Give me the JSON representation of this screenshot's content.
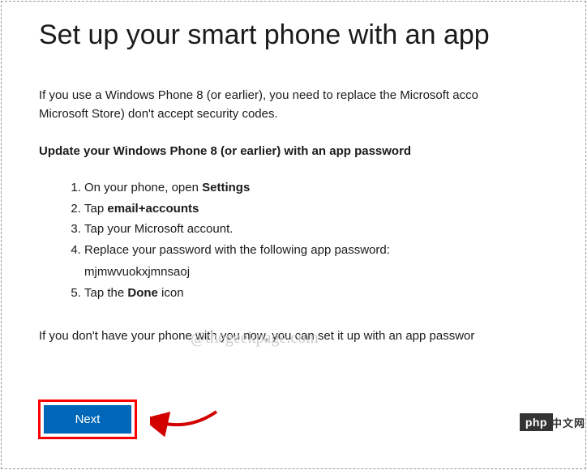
{
  "title": "Set up your smart phone with an app",
  "intro_line1": "If you use a Windows Phone 8 (or earlier), you need to replace the Microsoft acco",
  "intro_line2": "Microsoft Store) don't accept security codes.",
  "section_heading": "Update your Windows Phone 8 (or earlier) with an app password",
  "steps": {
    "s1a": "On your phone, open ",
    "s1b": "Settings",
    "s2a": "Tap ",
    "s2b": "email+accounts",
    "s3": "Tap your Microsoft account.",
    "s4": "Replace your password with the following app password:",
    "app_password": "mjmwvuokxjmnsaoj",
    "s5a": "Tap the ",
    "s5b": "Done",
    "s5c": " icon"
  },
  "watermark": "@thegeekpage.com",
  "outro": "If you don't have your phone with you now, you can set it up with an app passwor",
  "next_label": "Next",
  "logo": {
    "box": "php",
    "rest": "中文网"
  }
}
